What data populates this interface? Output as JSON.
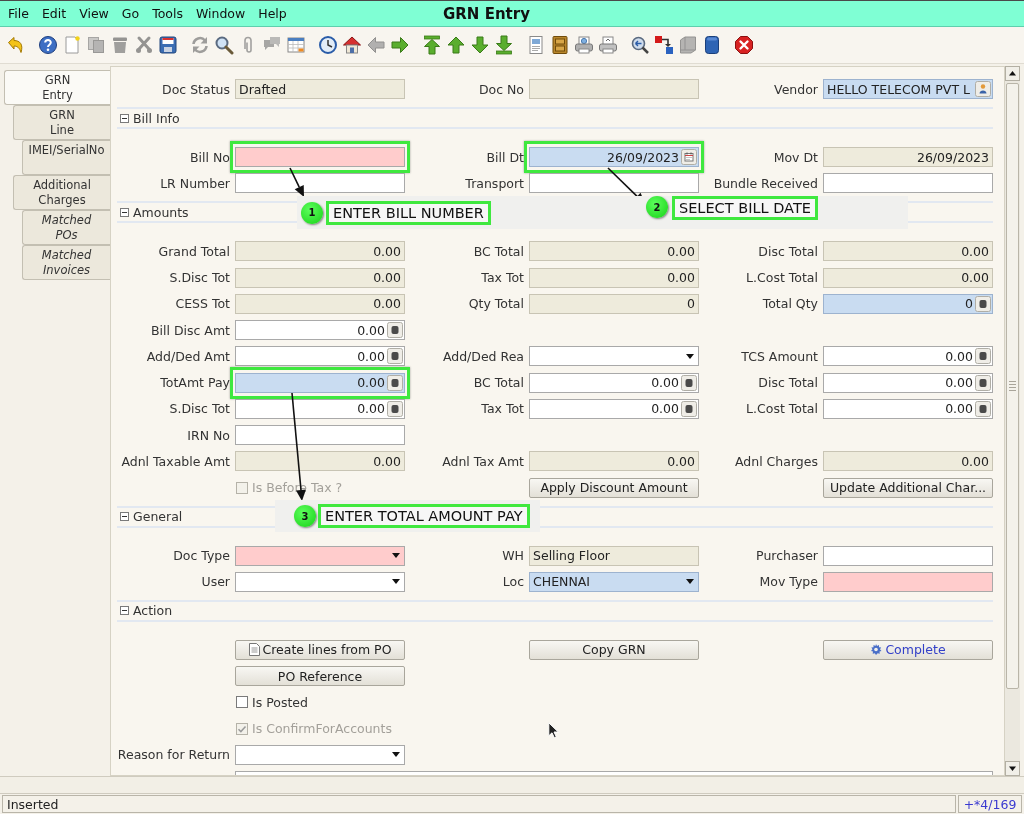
{
  "window": {
    "title": "GRN Entry"
  },
  "menu": [
    {
      "label": "File"
    },
    {
      "label": "Edit"
    },
    {
      "label": "View"
    },
    {
      "label": "Go"
    },
    {
      "label": "Tools"
    },
    {
      "label": "Window"
    },
    {
      "label": "Help"
    }
  ],
  "toolbar_groups": [
    [
      {
        "disabled": false
      }
    ],
    [
      {
        "disabled": false
      },
      {
        "disabled": false
      },
      {
        "disabled": true
      },
      {
        "disabled": true
      },
      {
        "disabled": true
      },
      {
        "disabled": false
      }
    ],
    [
      {
        "disabled": true
      },
      {
        "disabled": false
      },
      {
        "disabled": true
      },
      {
        "disabled": true
      },
      {
        "disabled": false
      }
    ],
    [
      {
        "disabled": false
      },
      {
        "disabled": false
      },
      {
        "disabled": true
      },
      {
        "disabled": false
      }
    ],
    [
      {
        "disabled": false
      },
      {
        "disabled": false
      },
      {
        "disabled": false
      },
      {
        "disabled": false
      }
    ],
    [
      {
        "disabled": false
      },
      {
        "disabled": false
      },
      {
        "disabled": false
      },
      {
        "disabled": false
      }
    ],
    [
      {
        "disabled": false
      },
      {
        "disabled": false
      },
      {
        "disabled": true
      },
      {
        "disabled": false
      }
    ],
    [
      {
        "disabled": false
      }
    ]
  ],
  "tabs": [
    {
      "label": "GRN Entry",
      "selected": true,
      "read_only": false,
      "children": [
        {
          "label": "GRN Line",
          "selected": false,
          "read_only": false,
          "children": [
            {
              "label": "IMEI/SerialNo",
              "selected": false,
              "read_only": false
            }
          ]
        },
        {
          "label": "Additional Charges",
          "selected": false,
          "read_only": false,
          "children": [
            {
              "label": "Matched POs",
              "selected": false,
              "read_only": true
            },
            {
              "label": "Matched Invoices",
              "selected": false,
              "read_only": true
            }
          ]
        }
      ]
    }
  ],
  "form": {
    "sections": [
      {
        "rows": [
          {
            "left": {
              "label": "Doc Status",
              "kind": "text",
              "value": "Drafted",
              "read_only": true,
              "mandatory": false,
              "highlighted": false,
              "outlined": false
            },
            "middle": {
              "label": "Doc No",
              "kind": "text",
              "read_only": true,
              "mandatory": false,
              "highlighted": false,
              "outlined": false
            },
            "right": {
              "label": "Vendor",
              "kind": "search",
              "value": "HELLO TELECOM PVT L",
              "read_only": false,
              "mandatory": false,
              "highlighted": true,
              "outlined": false
            }
          }
        ]
      },
      {
        "title": "Bill Info",
        "expanded": true,
        "rows": [
          {
            "left": {
              "label": "Bill No",
              "kind": "text",
              "read_only": false,
              "mandatory": true,
              "highlighted": false,
              "outlined": true
            },
            "middle": {
              "label": "Bill Dt",
              "kind": "date",
              "value": "26/09/2023",
              "read_only": false,
              "mandatory": false,
              "highlighted": true,
              "outlined": true
            },
            "right": {
              "label": "Mov Dt",
              "kind": "date",
              "value": "26/09/2023",
              "read_only": true,
              "mandatory": false,
              "highlighted": false,
              "outlined": false
            }
          },
          {
            "left": {
              "label": "LR Number",
              "kind": "text",
              "read_only": false,
              "mandatory": false,
              "highlighted": false,
              "outlined": false
            },
            "middle": {
              "label": "Transport",
              "kind": "text",
              "read_only": false,
              "mandatory": false,
              "highlighted": false,
              "outlined": false
            },
            "right": {
              "label": "Bundle Received",
              "kind": "text",
              "read_only": false,
              "mandatory": false,
              "highlighted": false,
              "outlined": false
            }
          }
        ]
      },
      {
        "title": "Amounts",
        "expanded": true,
        "rows": [
          {
            "left": {
              "label": "Grand Total",
              "kind": "number",
              "value": "0.00",
              "read_only": true,
              "mandatory": false,
              "highlighted": false,
              "outlined": false
            },
            "middle": {
              "label": "BC Total",
              "kind": "number",
              "value": "0.00",
              "read_only": true,
              "mandatory": false,
              "highlighted": false,
              "outlined": false
            },
            "right": {
              "label": "Disc Total",
              "kind": "number",
              "value": "0.00",
              "read_only": true,
              "mandatory": false,
              "highlighted": false,
              "outlined": false
            }
          },
          {
            "left": {
              "label": "S.Disc Tot",
              "kind": "number",
              "value": "0.00",
              "read_only": true,
              "mandatory": false,
              "highlighted": false,
              "outlined": false
            },
            "middle": {
              "label": "Tax Tot",
              "kind": "number",
              "value": "0.00",
              "read_only": true,
              "mandatory": false,
              "highlighted": false,
              "outlined": false
            },
            "right": {
              "label": "L.Cost Total",
              "kind": "number",
              "value": "0.00",
              "read_only": true,
              "mandatory": false,
              "highlighted": false,
              "outlined": false
            }
          },
          {
            "left": {
              "label": "CESS Tot",
              "kind": "number",
              "value": "0.00",
              "read_only": true,
              "mandatory": false,
              "highlighted": false,
              "outlined": false
            },
            "middle": {
              "label": "Qty Total",
              "kind": "number",
              "value": "0",
              "read_only": true,
              "mandatory": false,
              "highlighted": false,
              "outlined": false
            },
            "right": {
              "label": "Total Qty",
              "kind": "number",
              "value": "0",
              "read_only": false,
              "mandatory": false,
              "highlighted": true,
              "outlined": false
            }
          },
          {
            "left": {
              "label": "Bill Disc Amt",
              "kind": "number",
              "value": "0.00",
              "read_only": false,
              "mandatory": false,
              "highlighted": false,
              "outlined": false
            }
          },
          {
            "left": {
              "label": "Add/Ded Amt",
              "kind": "number",
              "value": "0.00",
              "read_only": false,
              "mandatory": false,
              "highlighted": false,
              "outlined": false
            },
            "middle": {
              "label": "Add/Ded Rea",
              "kind": "list",
              "read_only": false,
              "mandatory": false,
              "highlighted": false,
              "outlined": false
            },
            "right": {
              "label": "TCS Amount",
              "kind": "number",
              "value": "0.00",
              "read_only": false,
              "mandatory": false,
              "highlighted": false,
              "outlined": false
            }
          },
          {
            "left": {
              "label": "TotAmt Pay",
              "kind": "number",
              "value": "0.00",
              "read_only": false,
              "mandatory": false,
              "highlighted": true,
              "outlined": true
            },
            "middle": {
              "label": "BC Total",
              "kind": "number",
              "value": "0.00",
              "read_only": false,
              "mandatory": false,
              "highlighted": false,
              "outlined": false
            },
            "right": {
              "label": "Disc Total",
              "kind": "number",
              "value": "0.00",
              "read_only": false,
              "mandatory": false,
              "highlighted": false,
              "outlined": false
            }
          },
          {
            "left": {
              "label": "S.Disc Tot",
              "kind": "number",
              "value": "0.00",
              "read_only": false,
              "mandatory": false,
              "highlighted": false,
              "outlined": false
            },
            "middle": {
              "label": "Tax Tot",
              "kind": "number",
              "value": "0.00",
              "read_only": false,
              "mandatory": false,
              "highlighted": false,
              "outlined": false
            },
            "right": {
              "label": "L.Cost Total",
              "kind": "number",
              "value": "0.00",
              "read_only": false,
              "mandatory": false,
              "highlighted": false,
              "outlined": false
            }
          },
          {
            "left": {
              "label": "IRN No",
              "kind": "text",
              "read_only": false,
              "mandatory": false,
              "highlighted": false,
              "outlined": false
            }
          },
          {
            "left": {
              "label": "Adnl Taxable Amt",
              "kind": "number",
              "value": "0.00",
              "read_only": true,
              "mandatory": false,
              "highlighted": false,
              "outlined": false
            },
            "middle": {
              "label": "Adnl Tax Amt",
              "kind": "number",
              "value": "0.00",
              "read_only": true,
              "mandatory": false,
              "highlighted": false,
              "outlined": false
            },
            "right": {
              "label": "Adnl Charges",
              "kind": "number",
              "value": "0.00",
              "read_only": true,
              "mandatory": false,
              "highlighted": false,
              "outlined": false
            }
          },
          {
            "left": {
              "kind": "check",
              "label": "Is Before Tax ?",
              "checked": false,
              "read_only": true
            },
            "middle": {
              "kind": "button",
              "label": "Apply Discount Amount"
            },
            "right": {
              "kind": "button",
              "label": "Update Additional Char..."
            }
          }
        ]
      },
      {
        "title": "General",
        "expanded": true,
        "rows": [
          {
            "left": {
              "label": "Doc Type",
              "kind": "list",
              "read_only": false,
              "mandatory": true,
              "highlighted": false,
              "outlined": false
            },
            "middle": {
              "label": "WH",
              "kind": "text",
              "value": "Selling Floor",
              "read_only": true,
              "mandatory": false,
              "highlighted": false,
              "outlined": false
            },
            "right": {
              "label": "Purchaser",
              "kind": "text",
              "read_only": false,
              "mandatory": false,
              "highlighted": false,
              "outlined": false
            }
          },
          {
            "left": {
              "label": "User",
              "kind": "list",
              "read_only": false,
              "mandatory": false,
              "highlighted": false,
              "outlined": false
            },
            "middle": {
              "label": "Loc",
              "kind": "list",
              "value": "CHENNAI",
              "read_only": false,
              "mandatory": false,
              "highlighted": true,
              "outlined": false
            },
            "right": {
              "label": "Mov Type",
              "kind": "text",
              "read_only": false,
              "mandatory": true,
              "highlighted": false,
              "outlined": false
            }
          }
        ]
      },
      {
        "title": "Action",
        "expanded": true,
        "rows": [
          {
            "left": {
              "kind": "process",
              "label": "Create lines from PO"
            },
            "middle": {
              "kind": "button",
              "label": "Copy GRN"
            },
            "right": {
              "kind": "docaction",
              "label": "Complete"
            }
          },
          {
            "left": {
              "kind": "button",
              "label": "PO Reference"
            }
          },
          {
            "left": {
              "kind": "check",
              "label": "Is Posted",
              "checked": false,
              "read_only": false
            }
          },
          {
            "left": {
              "kind": "check",
              "label": "Is ConfirmForAccounts",
              "checked": true,
              "read_only": true
            }
          },
          {
            "left": {
              "label": "Reason for Return",
              "kind": "list",
              "read_only": false,
              "mandatory": false,
              "highlighted": false,
              "outlined": false
            }
          },
          {
            "wide": {
              "kind": "textarea",
              "read_only": false
            }
          }
        ]
      }
    ]
  },
  "annotations": [
    {
      "number": "1",
      "text": "ENTER BILL NUMBER"
    },
    {
      "number": "2",
      "text": "SELECT BILL DATE"
    },
    {
      "number": "3",
      "text": "ENTER TOTAL AMOUNT PAY"
    }
  ],
  "status_bar": {
    "message": "Inserted",
    "record": "+*4/169"
  }
}
